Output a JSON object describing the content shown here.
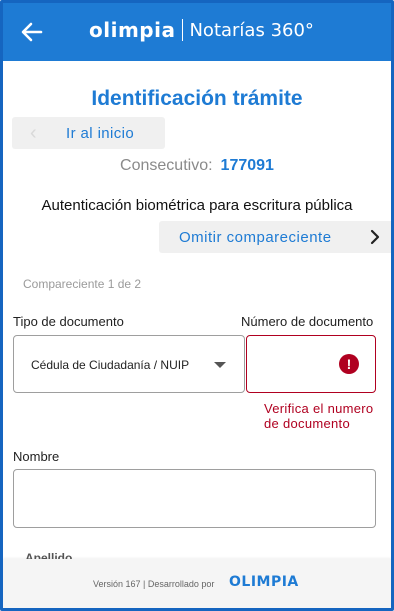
{
  "header": {
    "brand_logo": "OLIMPIA",
    "brand_subtitle": "Notarías 360°",
    "back_icon": "arrow-left-icon",
    "color": "#1e7bd4"
  },
  "page": {
    "title": "Identificación trámite",
    "home_button_label": "Ir al inicio",
    "consecutive_label": "Consecutivo:",
    "consecutive_value": "177091",
    "auth_title": "Autenticación biométrica para escritura pública",
    "omit_button_label": "Omitir compareciente",
    "compareciente_counter": "Compareciente 1 de 2"
  },
  "form": {
    "doc_type_label": "Tipo de documento",
    "doc_type_value": "Cédula de Ciudadanía / NUIP",
    "doc_number_label": "Número de documento",
    "doc_number_value": "",
    "doc_number_error": "Verifica el numero de documento",
    "name_label": "Nombre",
    "name_value": "",
    "surname_label": "Apellido"
  },
  "footer": {
    "text": "Versión 167 | Desarrollado por",
    "logo": "OLIMPIA"
  },
  "colors": {
    "accent": "#1e7bd4",
    "error": "#b00020"
  }
}
